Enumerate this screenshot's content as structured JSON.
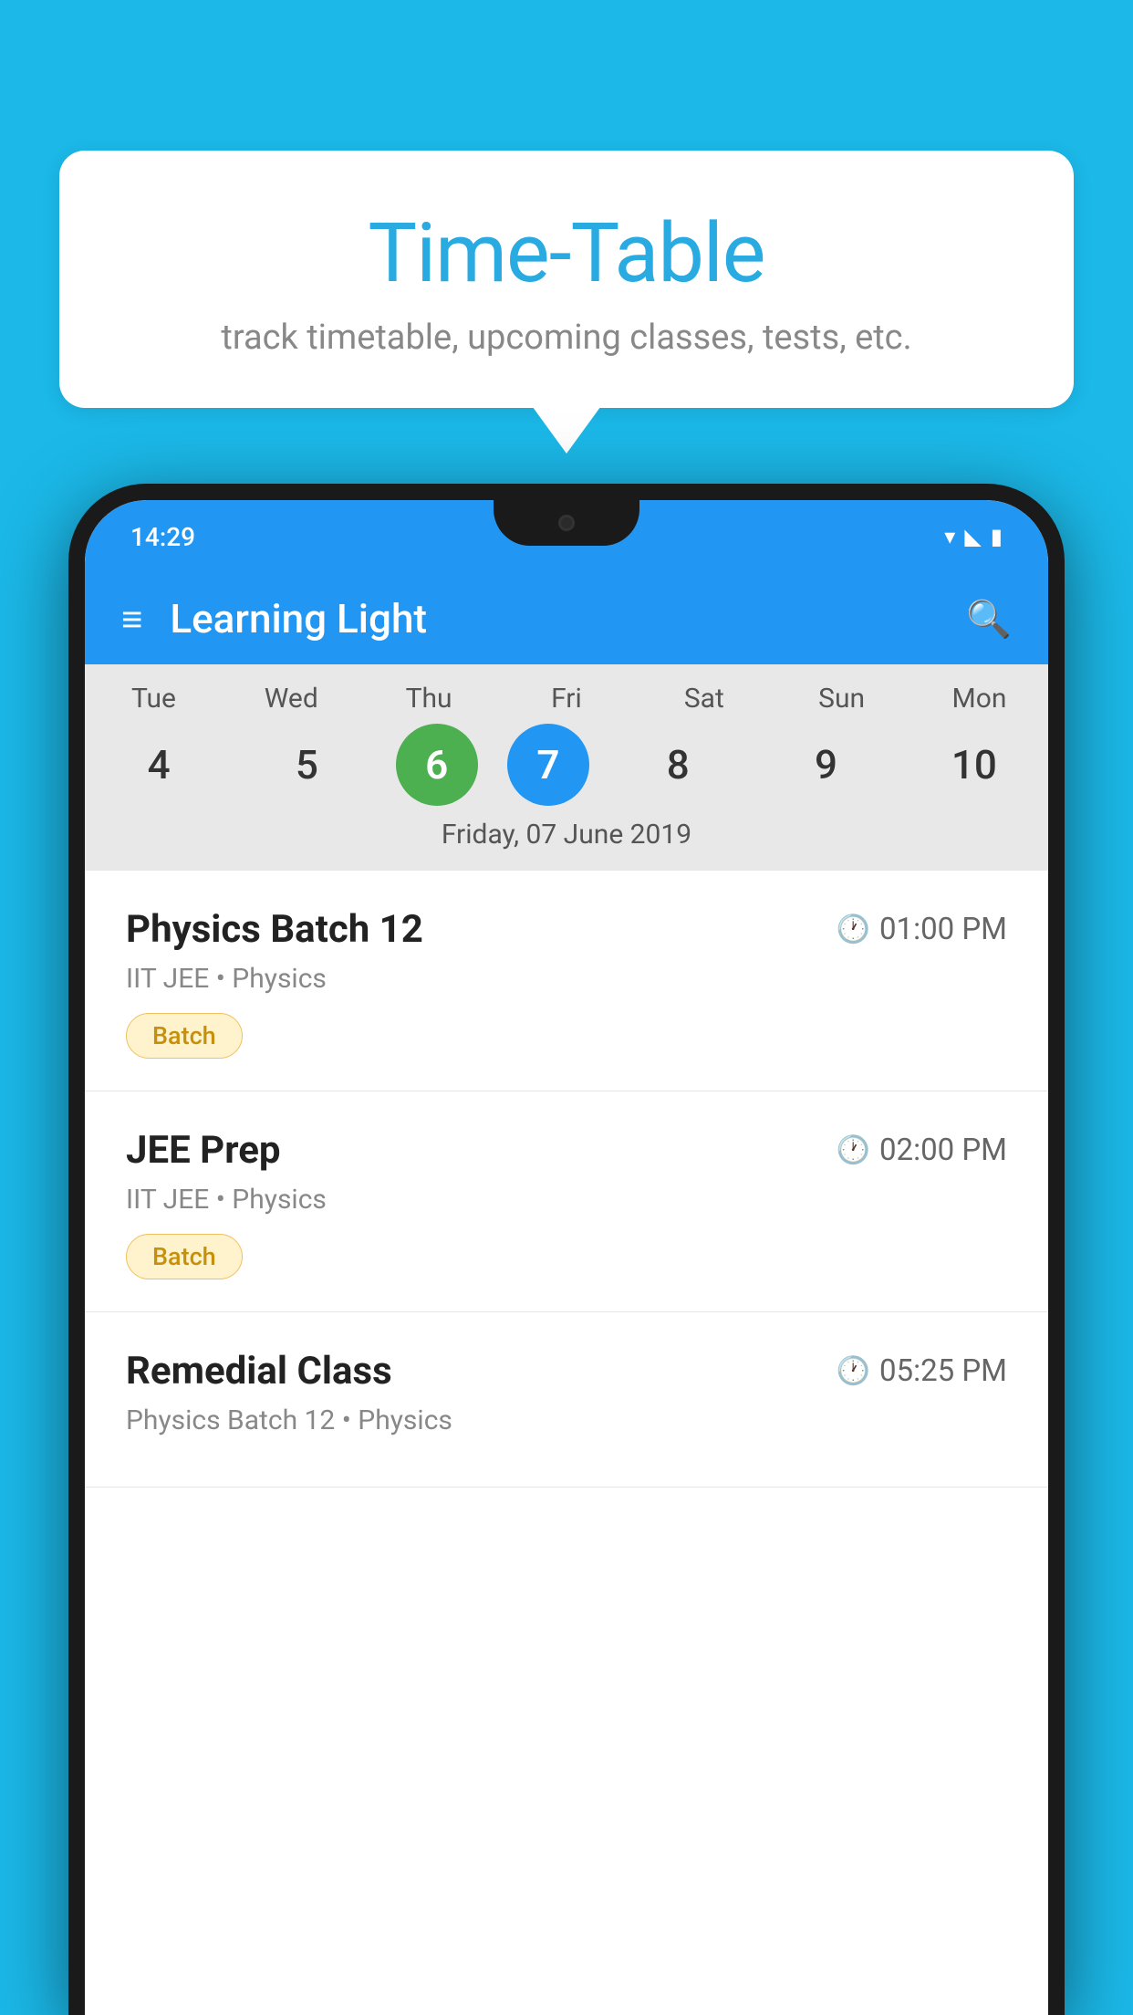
{
  "background_color": "#1BB8E8",
  "tooltip": {
    "title": "Time-Table",
    "subtitle": "track timetable, upcoming classes, tests, etc."
  },
  "phone": {
    "status_bar": {
      "time": "14:29",
      "icons": [
        "wifi",
        "signal",
        "battery"
      ]
    },
    "toolbar": {
      "title": "Learning Light",
      "menu_icon": "≡",
      "search_icon": "🔍"
    },
    "calendar": {
      "days": [
        {
          "name": "Tue",
          "number": "4",
          "state": "normal"
        },
        {
          "name": "Wed",
          "number": "5",
          "state": "normal"
        },
        {
          "name": "Thu",
          "number": "6",
          "state": "today"
        },
        {
          "name": "Fri",
          "number": "7",
          "state": "selected"
        },
        {
          "name": "Sat",
          "number": "8",
          "state": "normal"
        },
        {
          "name": "Sun",
          "number": "9",
          "state": "normal"
        },
        {
          "name": "Mon",
          "number": "10",
          "state": "normal"
        }
      ],
      "selected_date_label": "Friday, 07 June 2019"
    },
    "schedule": [
      {
        "title": "Physics Batch 12",
        "time": "01:00 PM",
        "subtitle": "IIT JEE • Physics",
        "badge": "Batch"
      },
      {
        "title": "JEE Prep",
        "time": "02:00 PM",
        "subtitle": "IIT JEE • Physics",
        "badge": "Batch"
      },
      {
        "title": "Remedial Class",
        "time": "05:25 PM",
        "subtitle": "Physics Batch 12 • Physics",
        "badge": null
      }
    ]
  }
}
